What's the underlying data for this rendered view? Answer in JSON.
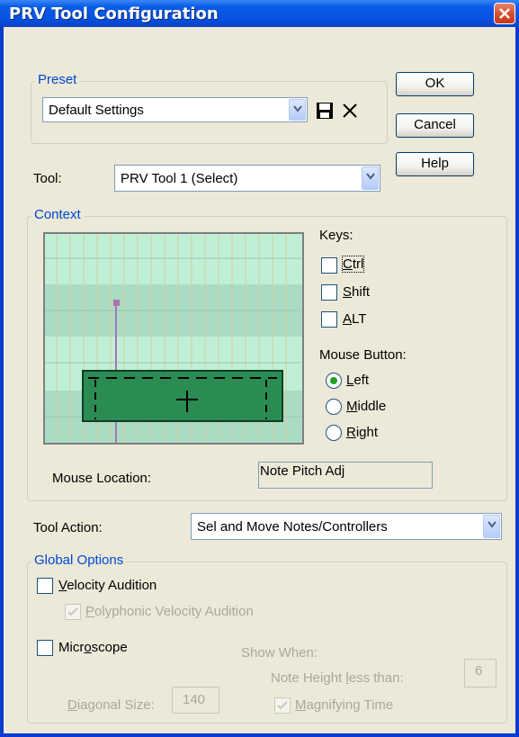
{
  "window": {
    "title": "PRV Tool Configuration"
  },
  "buttons": {
    "ok": "OK",
    "cancel": "Cancel",
    "help": "Help"
  },
  "preset": {
    "group_label": "Preset",
    "value": "Default Settings"
  },
  "tool": {
    "label": "Tool:",
    "value": "PRV Tool 1 (Select)"
  },
  "context": {
    "group_label": "Context",
    "keys_label": "Keys:",
    "keys": [
      {
        "accel": "C",
        "rest": "trl",
        "checked": false
      },
      {
        "accel": "S",
        "rest": "hift",
        "checked": false
      },
      {
        "accel": "A",
        "rest": "LT",
        "checked": false
      }
    ],
    "mouse_button_label": "Mouse Button:",
    "mouse_buttons": [
      {
        "accel": "L",
        "rest": "eft",
        "selected": true
      },
      {
        "accel": "M",
        "rest": "iddle",
        "selected": false
      },
      {
        "accel": "R",
        "rest": "ight",
        "selected": false
      }
    ],
    "mouse_location_label": "Mouse Location:",
    "mouse_location_value": "Note Pitch Adj"
  },
  "tool_action": {
    "label": "Tool Action:",
    "value": "Sel and Move Notes/Controllers"
  },
  "global_options": {
    "group_label": "Global Options",
    "velocity_audition": {
      "accel": "V",
      "rest": "elocity Audition",
      "checked": false
    },
    "polyphonic_velocity_audition": {
      "accel": "P",
      "rest": "olyphonic Velocity Audition",
      "checked": true
    },
    "microscope": {
      "pre": "Micr",
      "accel": "o",
      "rest": "scope",
      "checked": false
    },
    "show_when_label": "Show When:",
    "note_height": {
      "pre": "Note Height ",
      "accel": "l",
      "rest": "ess than:",
      "value": "6"
    },
    "diagonal_size": {
      "accel": "D",
      "rest": "iagonal Size:",
      "value": "140"
    },
    "magnifying_time": {
      "accel": "M",
      "rest": "agnifying Time",
      "checked": true
    }
  }
}
